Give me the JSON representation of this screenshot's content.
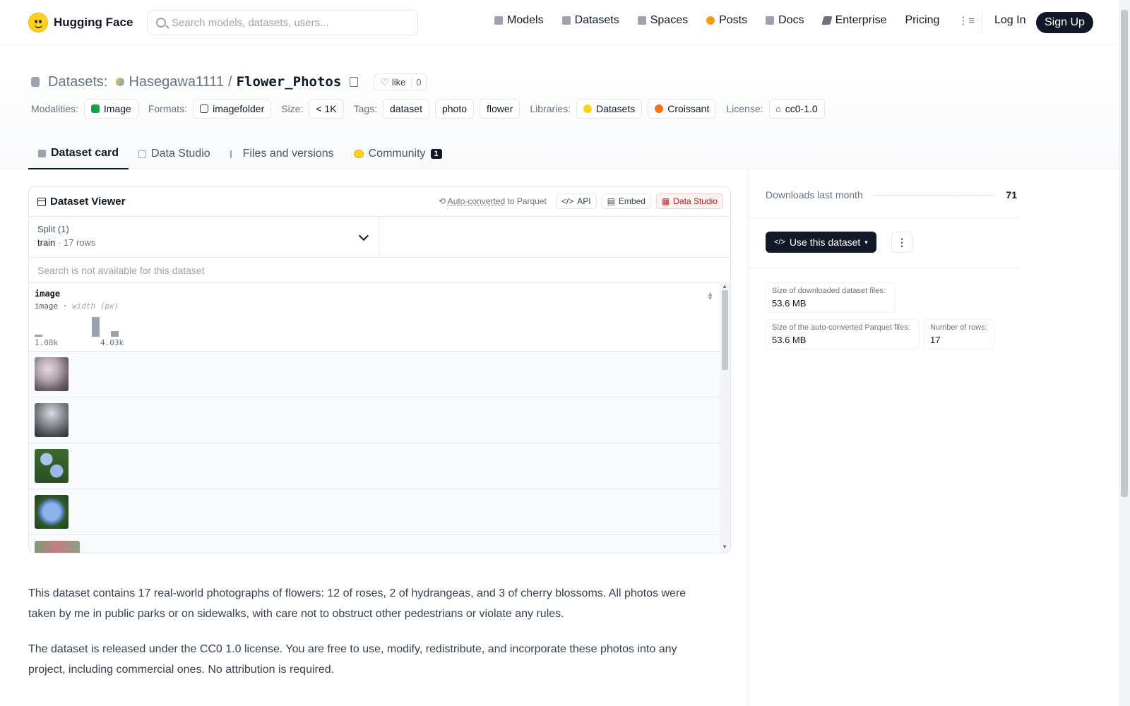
{
  "header": {
    "brand": "Hugging Face",
    "search_placeholder": "Search models, datasets, users...",
    "nav": [
      {
        "label": "Models",
        "icon": "models-icon",
        "color": "#9ca3af"
      },
      {
        "label": "Datasets",
        "icon": "datasets-icon",
        "color": "#9ca3af"
      },
      {
        "label": "Spaces",
        "icon": "spaces-icon",
        "color": "#9ca3af"
      },
      {
        "label": "Posts",
        "icon": "posts-icon",
        "color": "#f59e0b"
      },
      {
        "label": "Docs",
        "icon": "docs-icon",
        "color": "#9ca3af"
      },
      {
        "label": "Enterprise",
        "icon": "enterprise-icon",
        "color": "#6b7280"
      },
      {
        "label": "Pricing"
      }
    ],
    "login": "Log In",
    "signup": "Sign Up"
  },
  "dataset": {
    "section": "Datasets:",
    "owner": "Hasegawa1111",
    "separator": "/",
    "name": "Flower_Photos",
    "like_label": "like",
    "like_count": "0",
    "meta": {
      "modalities_label": "Modalities:",
      "modality": "Image",
      "formats_label": "Formats:",
      "format": "imagefolder",
      "size_label": "Size:",
      "size": "< 1K",
      "tags_label": "Tags:",
      "tags": [
        "dataset",
        "photo",
        "flower"
      ],
      "libraries_label": "Libraries:",
      "libraries": [
        "Datasets",
        "Croissant"
      ],
      "license_label": "License:",
      "license": "cc0-1.0"
    },
    "tabs": [
      {
        "label": "Dataset card",
        "active": true
      },
      {
        "label": "Data Studio"
      },
      {
        "label": "Files and versions"
      },
      {
        "label": "Community",
        "badge": "1"
      }
    ]
  },
  "viewer": {
    "title": "Dataset Viewer",
    "auto_converted": "Auto-converted",
    "to_parquet": "to Parquet",
    "api": "API",
    "embed": "Embed",
    "data_studio": "Data Studio",
    "split_label": "Split (1)",
    "split_name": "train",
    "split_rows": "17 rows",
    "search_placeholder": "Search is not available for this dataset",
    "column": {
      "name": "image",
      "type": "image",
      "stat": "width (px)",
      "min": "1.08k",
      "max": "4.03k",
      "histogram": [
        0.1,
        0,
        0,
        0,
        0,
        0,
        1.0,
        0,
        0.3
      ]
    },
    "rows": [
      {
        "thumb": "cherry-blossom"
      },
      {
        "thumb": "cherry-blossom-tree"
      },
      {
        "thumb": "hydrangea"
      },
      {
        "thumb": "hydrangea"
      },
      {
        "thumb": "rose"
      }
    ]
  },
  "description": [
    "This dataset contains 17 real-world photographs of flowers: 12 of roses, 2 of hydrangeas, and 3 of cherry blossoms. All photos were taken by me in public parks or on sidewalks, with care not to obstruct other pedestrians or violate any rules.",
    "The dataset is released under the CC0 1.0 license. You are free to use, modify, redistribute, and incorporate these photos into any project, including commercial ones. No attribution is required."
  ],
  "sidebar": {
    "downloads_label": "Downloads last month",
    "downloads_value": "71",
    "use_button": "Use this dataset",
    "stats": [
      {
        "label": "Size of downloaded dataset files:",
        "value": "53.6 MB"
      },
      {
        "label": "Size of the auto-converted Parquet files:",
        "value": "53.6 MB"
      },
      {
        "label": "Number of rows:",
        "value": "17"
      }
    ]
  }
}
